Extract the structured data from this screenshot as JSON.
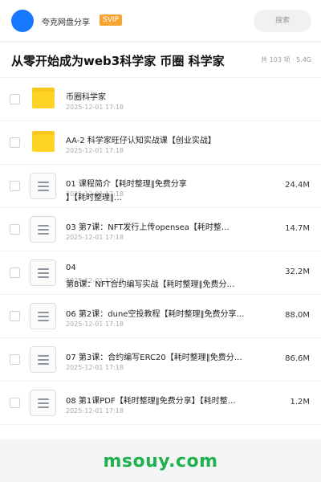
{
  "header": {
    "app_name": "夸克网盘分享",
    "badge": "SVIP",
    "search_placeholder": "搜索"
  },
  "title_bar": {
    "title": "从零开始成为web3科学家 币圈 科学家",
    "meta": "共 103 项 · 5.4G"
  },
  "files": [
    {
      "type": "folder",
      "name": "币圈科学家",
      "date": "2025-12-01 17:18",
      "size": ""
    },
    {
      "type": "folder",
      "name": "AA-2 科学家旺仔认知实战课【创业实战】",
      "date": "2025-12-01 17:18",
      "size": ""
    },
    {
      "type": "file",
      "name": "01 课程简介【耗时整理‖免费分享",
      "name_line2": "】【耗时整理‖…",
      "date": "2025-12-01 17:18",
      "size": "24.4M"
    },
    {
      "type": "file",
      "name": "03 第7课：NFT发行上传opensea【耗时整…",
      "date": "2025-12-01 17:18",
      "size": "14.7M"
    },
    {
      "type": "file",
      "name": "04",
      "name_line2": "第8课：NFT合约编写实战【耗时整理‖免费分…",
      "date": "2025-12-01 17:18",
      "size": "32.2M"
    },
    {
      "type": "file",
      "name": "06 第2课：dune空投教程【耗时整理‖免费分享…",
      "date": "2025-12-01 17:18",
      "size": "88.0M"
    },
    {
      "type": "file",
      "name": "07 第3课：合约编写ERC20【耗时整理‖免费分…",
      "date": "2025-12-01 17:18",
      "size": "86.6M"
    },
    {
      "type": "file",
      "name": "08 第1课PDF【耗时整理‖免费分享】【耗时整…",
      "date": "2025-12-01 17:18",
      "size": "1.2M"
    }
  ],
  "watermark": "msouy.com",
  "colors": {
    "accent": "#1677ff",
    "badge": "#f7a531",
    "folder": "#ffd427",
    "watermark": "#1fb14b"
  }
}
